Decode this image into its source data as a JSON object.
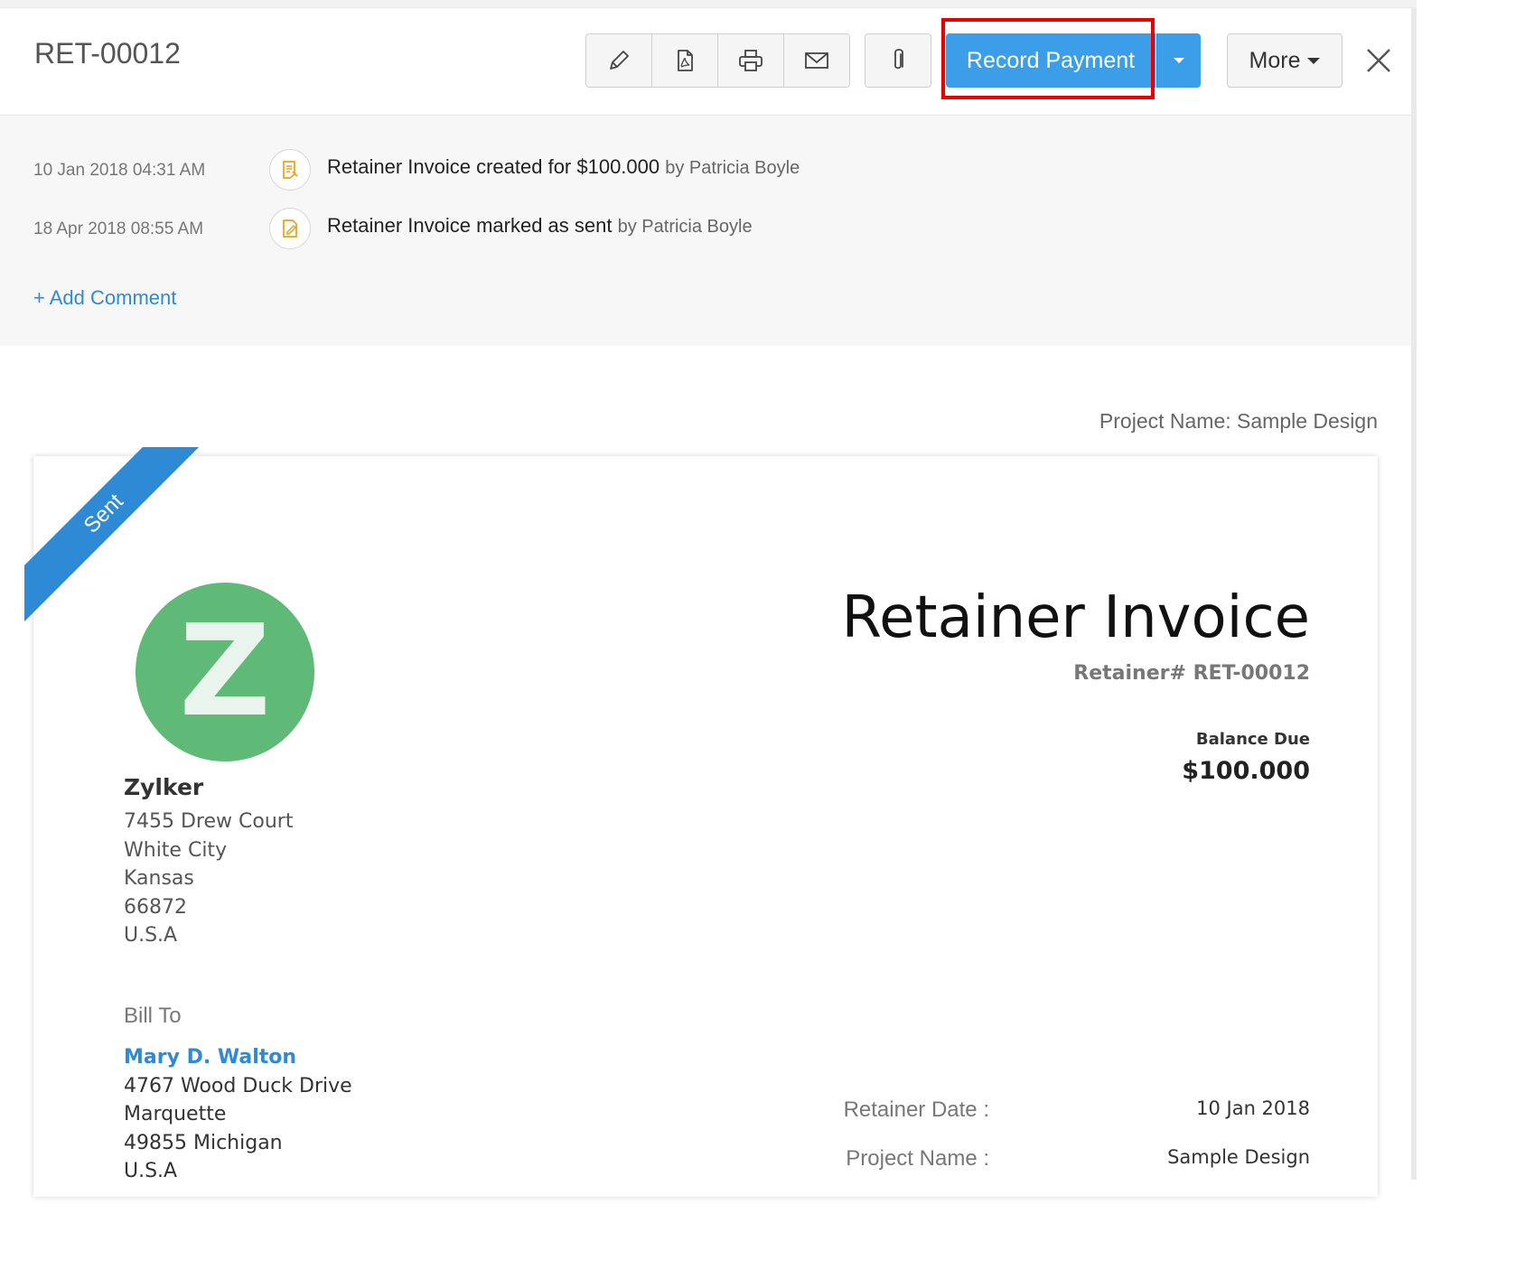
{
  "header": {
    "doc_id": "RET-00012",
    "icons": [
      "pencil-icon",
      "pdf-icon",
      "printer-icon",
      "mail-icon",
      "paperclip-icon"
    ],
    "record_payment_label": "Record Payment",
    "more_label": "More",
    "accent_color": "#3c9ee8"
  },
  "activity": {
    "items": [
      {
        "date": "10 Jan 2018 04:31 AM",
        "text": "Retainer Invoice created for $100.000",
        "by": "by Patricia Boyle"
      },
      {
        "date": "18 Apr 2018 08:55 AM",
        "text": "Retainer Invoice marked as sent",
        "by": "by Patricia Boyle"
      }
    ],
    "add_comment": "+ Add Comment"
  },
  "project_line": "Project Name: Sample Design",
  "invoice": {
    "ribbon": "Sent",
    "logo_letter": "Z",
    "company": {
      "name": "Zylker",
      "address": [
        "7455 Drew Court",
        "White City",
        "Kansas",
        "66872",
        "U.S.A"
      ]
    },
    "title": "Retainer Invoice",
    "number": "Retainer# RET-00012",
    "balance_label": "Balance Due",
    "balance_amount": "$100.000",
    "bill_to_label": "Bill To",
    "customer": {
      "name": "Mary D. Walton",
      "address": [
        "4767 Wood Duck Drive",
        "Marquette",
        "49855 Michigan",
        "U.S.A"
      ]
    },
    "details": [
      {
        "label": "Retainer Date :",
        "value": "10 Jan 2018"
      },
      {
        "label": "Project Name :",
        "value": "Sample Design"
      }
    ]
  }
}
